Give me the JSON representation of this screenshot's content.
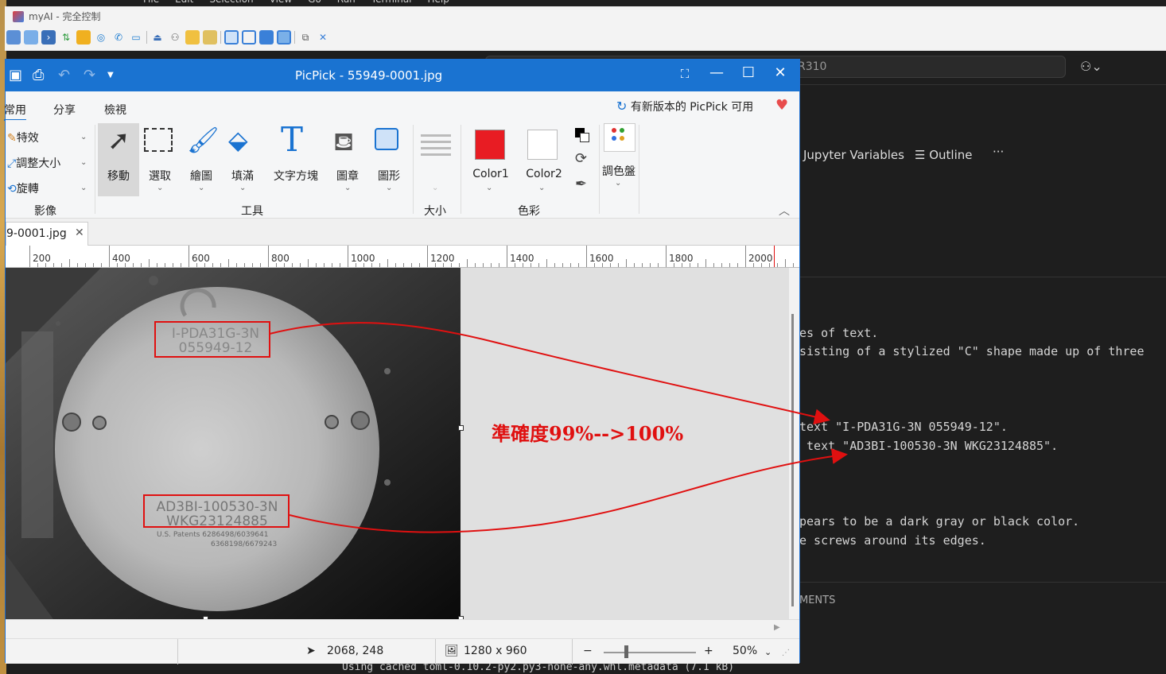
{
  "vscode": {
    "menu": [
      "File",
      "Edit",
      "Selection",
      "View",
      "Go",
      "Run",
      "Terminal",
      "Help"
    ],
    "search_text": "R310",
    "panel_tabs": [
      "Jupyter Variables",
      "Outline"
    ],
    "more": "···",
    "output_lines": [
      "es of text.",
      "sisting of a stylized \"C\" shape made up of three",
      "text \"I-PDA31G-3N 055949-12\".",
      " text \"AD3BI-100530-3N WKG23124885\".",
      "pears to be a dark gray or black color.",
      "e screws around its edges."
    ],
    "section": "MENTS",
    "bottom_line": "Using cached toml-0.10.2-py2.py3-none-any.whl.metadata (7.1 kB)"
  },
  "myai": {
    "title": "myAI - 完全控制"
  },
  "picpick": {
    "title": "PicPick - 55949-0001.jpg",
    "menu": [
      "常用",
      "分享",
      "檢視"
    ],
    "update_notice": "有新版本的 PicPick 可用",
    "image_group": {
      "items": [
        "特效",
        "調整大小",
        "旋轉"
      ],
      "label": "影像"
    },
    "tools": [
      "移動",
      "選取",
      "繪圖",
      "填滿",
      "文字方塊",
      "圖章",
      "圖形"
    ],
    "tools_label": "工具",
    "size_label": "大小",
    "color1_label": "Color1",
    "color2_label": "Color2",
    "color_group_label": "色彩",
    "palette_label": "調色盤",
    "colors": {
      "color1": "#e81c23",
      "color2": "#ffffff",
      "accent": "#1a73d1"
    },
    "tab_name": "9-0001.jpg",
    "ruler": [
      "200",
      "400",
      "600",
      "800",
      "1000",
      "1200",
      "1400",
      "1600",
      "1800",
      "2000"
    ],
    "status": {
      "cursor": "2068, 248",
      "dimensions": "1280 x 960",
      "zoom": "50%"
    }
  },
  "photo": {
    "label1": [
      "I-PDA31G-3N",
      "055949-12"
    ],
    "label2": [
      "AD3BI-100530-3N",
      "WKG23124885"
    ],
    "patents": [
      "U.S. Patents 6286498/6039641",
      "6368198/6679243"
    ]
  },
  "annotation": {
    "text": "準確度99%-->100%",
    "color": "#e01010"
  }
}
